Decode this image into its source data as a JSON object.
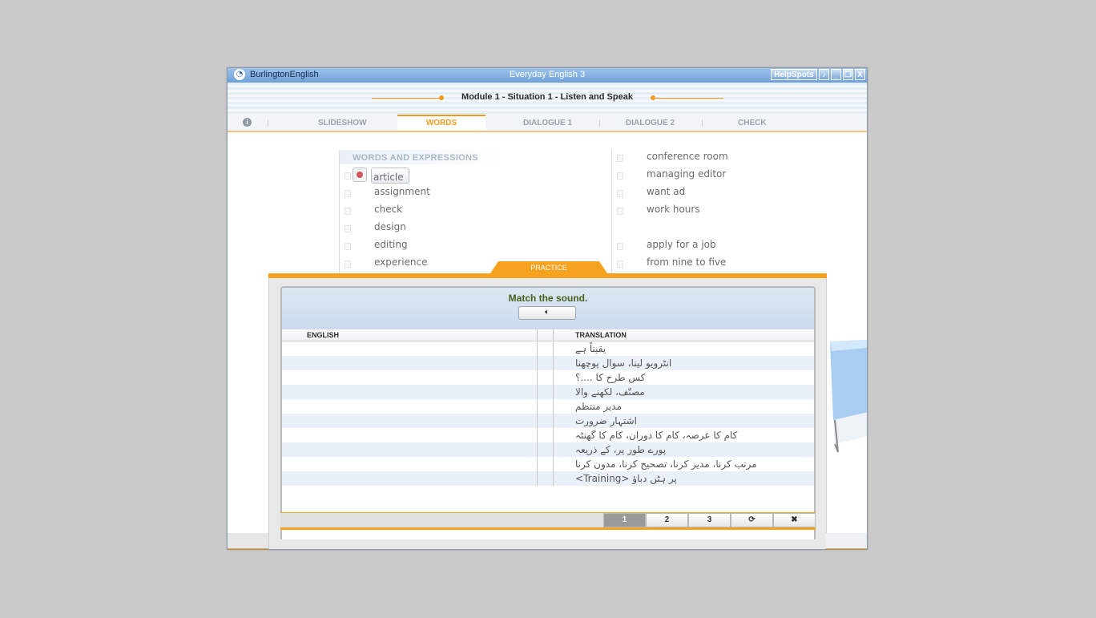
{
  "window": {
    "brand": "BurlingtonEnglish",
    "title": "Everyday English 3",
    "help_label": "HelpSpots",
    "controls": [
      "sound-icon",
      "minimize-icon",
      "restore-icon",
      "close-icon"
    ],
    "close_label": "X"
  },
  "module": {
    "title": "Module 1 - Situation 1 - Listen and Speak"
  },
  "tabs": {
    "info": "i",
    "items": [
      "SLIDESHOW",
      "WORDS",
      "DIALOGUE 1",
      "DIALOGUE 2",
      "CHECK"
    ],
    "active": "WORDS"
  },
  "words": {
    "heading": "WORDS AND EXPRESSIONS",
    "left": [
      "article",
      "assignment",
      "check",
      "design",
      "editing",
      "experience"
    ],
    "right": [
      "conference room",
      "managing editor",
      "want ad",
      "work hours",
      "apply for a job",
      "from nine to five"
    ],
    "selected": "article"
  },
  "practice": {
    "tab_label": "PRACTICE",
    "instruction": "Match the sound.",
    "col_english": "ENGLISH",
    "col_translation": "TRANSLATION",
    "translations": [
      "یقیناً ہے",
      "انٹرویو لینا، سوال پوچھنا",
      "کس طرح کا ....؟",
      "مصنّف، لکھنے والا",
      "مدیر منتظم",
      "اشتہار ضرورت",
      "کام کا عرصہ، کام کا دوران، کام کا گھنٹہ",
      "پورے طور پر، کے ذریعہ",
      "مرتب کرنا، مدیر کرنا، تصحیح کرنا، مدون کرنا",
      "پر ہٹں دباؤ <Training>"
    ],
    "pages": [
      "1",
      "2",
      "3"
    ],
    "current_page": "1",
    "refresh_icon": "refresh-icon",
    "close_icon": "close-icon"
  },
  "colors": {
    "accent": "#f7a21e",
    "titlebar": "#6fa0d6",
    "row_alt": "#e9f0f8"
  }
}
